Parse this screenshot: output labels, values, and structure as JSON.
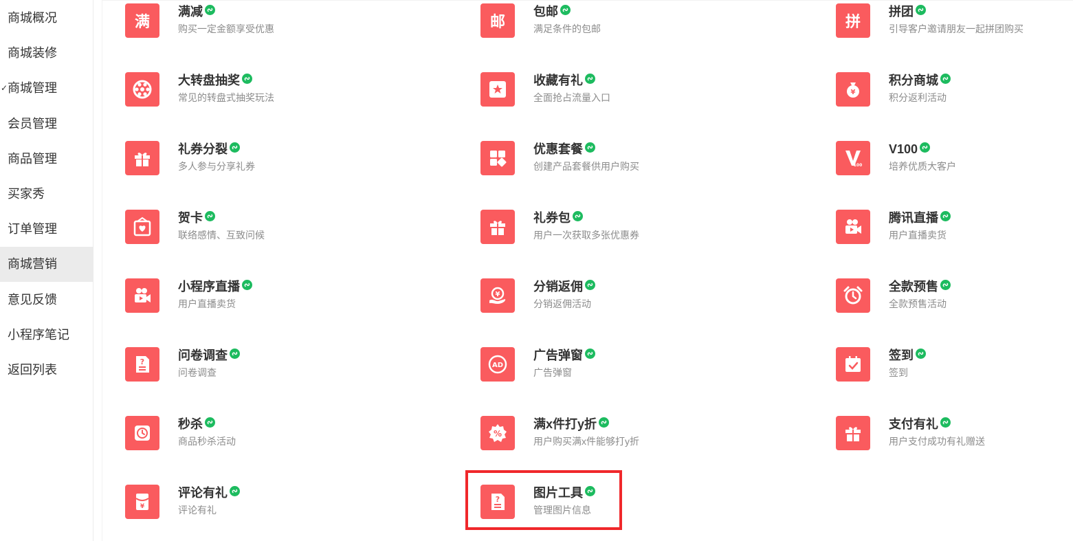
{
  "sidebar": {
    "items": [
      {
        "label": "商城概况",
        "active": false,
        "checked": false
      },
      {
        "label": "商城装修",
        "active": false,
        "checked": false
      },
      {
        "label": "商城管理",
        "active": false,
        "checked": true
      },
      {
        "label": "会员管理",
        "active": false,
        "checked": false
      },
      {
        "label": "商品管理",
        "active": false,
        "checked": false
      },
      {
        "label": "买家秀",
        "active": false,
        "checked": false
      },
      {
        "label": "订单管理",
        "active": false,
        "checked": false
      },
      {
        "label": "商城营销",
        "active": true,
        "checked": false
      },
      {
        "label": "意见反馈",
        "active": false,
        "checked": false
      },
      {
        "label": "小程序笔记",
        "active": false,
        "checked": false
      },
      {
        "label": "返回列表",
        "active": false,
        "checked": false
      }
    ]
  },
  "apps": [
    {
      "title": "满减",
      "desc": "购买一定金额享受优惠",
      "icon": "manjian-text-icon",
      "glyph": "满"
    },
    {
      "title": "包邮",
      "desc": "满足条件的包邮",
      "icon": "baoyou-text-icon",
      "glyph": "邮"
    },
    {
      "title": "拼团",
      "desc": "引导客户邀请朋友一起拼团购买",
      "icon": "pintuan-text-icon",
      "glyph": "拼"
    },
    {
      "title": "大转盘抽奖",
      "desc": "常见的转盘式抽奖玩法",
      "icon": "wheel-icon"
    },
    {
      "title": "收藏有礼",
      "desc": "全面抢占流量入口",
      "icon": "star-icon"
    },
    {
      "title": "积分商城",
      "desc": "积分返利活动",
      "icon": "money-bag-icon"
    },
    {
      "title": "礼券分裂",
      "desc": "多人参与分享礼券",
      "icon": "gift-icon"
    },
    {
      "title": "优惠套餐",
      "desc": "创建产品套餐供用户购买",
      "icon": "grid-blocks-icon"
    },
    {
      "title": "V100",
      "desc": "培养优质大客户",
      "icon": "v100-icon"
    },
    {
      "title": "贺卡",
      "desc": "联络感情、互致问候",
      "icon": "greeting-card-icon"
    },
    {
      "title": "礼券包",
      "desc": "用户一次获取多张优惠券",
      "icon": "gift-box-icon"
    },
    {
      "title": "腾讯直播",
      "desc": "用户直播卖货",
      "icon": "video-camera-icon"
    },
    {
      "title": "小程序直播",
      "desc": "用户直播卖货",
      "icon": "video-camera-icon"
    },
    {
      "title": "分销返佣",
      "desc": "分销返佣活动",
      "icon": "commission-hand-icon"
    },
    {
      "title": "全款预售",
      "desc": "全款预售活动",
      "icon": "alarm-clock-icon"
    },
    {
      "title": "问卷调查",
      "desc": "问卷调查",
      "icon": "questionnaire-icon"
    },
    {
      "title": "广告弹窗",
      "desc": "广告弹窗",
      "icon": "ad-icon"
    },
    {
      "title": "签到",
      "desc": "签到",
      "icon": "calendar-check-icon"
    },
    {
      "title": "秒杀",
      "desc": "商品秒杀活动",
      "icon": "clock-icon"
    },
    {
      "title": "满x件打y折",
      "desc": "用户购买满x件能够打y折",
      "icon": "discount-badge-icon"
    },
    {
      "title": "支付有礼",
      "desc": "用户支付成功有礼赠送",
      "icon": "gift-box-icon"
    },
    {
      "title": "评论有礼",
      "desc": "评论有礼",
      "icon": "red-envelope-icon"
    },
    {
      "title": "图片工具",
      "desc": "管理图片信息",
      "icon": "questionnaire-icon"
    }
  ],
  "ad_icon_text": "AD",
  "v100_icon_text": "100",
  "yen_symbol": "¥",
  "colors": {
    "icon_bg": "#fa5b5e",
    "mini_program_badge": "#1dbb5f",
    "highlight_border": "#f0282b",
    "sidebar_active_bg": "#ebebeb"
  },
  "highlighted_app": "图片工具"
}
